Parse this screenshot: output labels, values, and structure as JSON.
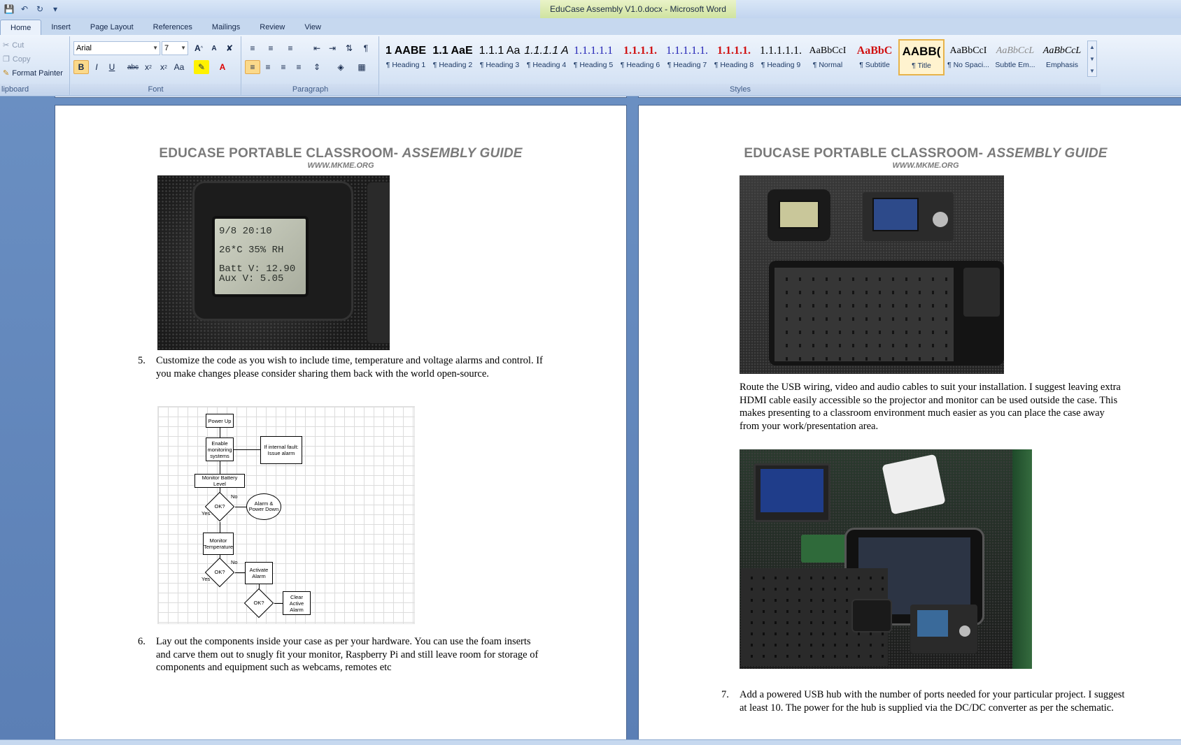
{
  "window": {
    "title": "EduCase Assembly V1.0.docx - Microsoft Word"
  },
  "tabs": [
    "Home",
    "Insert",
    "Page Layout",
    "References",
    "Mailings",
    "Review",
    "View"
  ],
  "clipboard": {
    "cut": "Cut",
    "copy": "Copy",
    "format_painter": "Format Painter",
    "label": "lipboard"
  },
  "font": {
    "name": "Arial",
    "size": "7",
    "label": "Font"
  },
  "paragraph": {
    "label": "Paragraph"
  },
  "styles": {
    "label": "Styles",
    "items": [
      {
        "sample": "1  AABE",
        "name": "¶ Heading 1"
      },
      {
        "sample": "1.1  AaE",
        "name": "¶ Heading 2"
      },
      {
        "sample": "1.1.1  Aa",
        "name": "¶ Heading 3"
      },
      {
        "sample": "1.1.1.1  A",
        "name": "¶ Heading 4"
      },
      {
        "sample": "1.1.1.1.1",
        "name": "¶ Heading 5"
      },
      {
        "sample": "1.1.1.1.",
        "name": "¶ Heading 6"
      },
      {
        "sample": "1.1.1.1.1.",
        "name": "¶ Heading 7"
      },
      {
        "sample": "1.1.1.1.",
        "name": "¶ Heading 8"
      },
      {
        "sample": "1.1.1.1.1.",
        "name": "¶ Heading 9"
      },
      {
        "sample": "AaBbCcI",
        "name": "¶ Normal"
      },
      {
        "sample": "AaBbC",
        "name": "¶ Subtitle"
      },
      {
        "sample": "AABB(",
        "name": "¶ Title"
      },
      {
        "sample": "AaBbCcI",
        "name": "¶ No Spaci..."
      },
      {
        "sample": "AaBbCcL",
        "name": "Subtle Em..."
      },
      {
        "sample": "AaBbCcL",
        "name": "Emphasis"
      }
    ]
  },
  "page_left": {
    "header_title": "EDUCASE PORTABLE CLASSROOM- ",
    "header_title_italic": "ASSEMBLY GUIDE",
    "header_url": "WWW.MKME.ORG",
    "lcd": {
      "line1": "9/8  20:10",
      "line2": "26*C  35% RH",
      "line3": "Batt V: 12.90",
      "line4": "Aux V: 5.05"
    },
    "step5_num": "5.",
    "step5_text": "Customize the code as you wish to include time, temperature and voltage alarms and control.  If you make changes please consider sharing them back with the world open-source.",
    "flowchart": {
      "power_up": "Power Up",
      "enable": "Enable monitoring systems",
      "fault": "If internal fault: Issue alarm",
      "battery": "Monitor Battery Level",
      "ok1": "OK?",
      "no1": "No",
      "yes1": "Yes",
      "alarm_power": "Alarm & Power Down",
      "temp": "Monitor Temperature",
      "ok2": "OK?",
      "no2": "No",
      "yes2": "Yes",
      "activate": "Activate Alarm",
      "ok3": "OK?",
      "clear": "Clear Active Alarm"
    },
    "step6_num": "6.",
    "step6_text": "Lay out the components inside your case as per your hardware.  You can use the foam inserts and carve them out to snugly fit your monitor, Raspberry Pi and still leave room for storage of components and equipment such as webcams, remotes etc"
  },
  "page_right": {
    "header_title": "EDUCASE PORTABLE CLASSROOM- ",
    "header_title_italic": "ASSEMBLY GUIDE",
    "header_url": "WWW.MKME.ORG",
    "route_text": "Route the USB wiring, video and audio cables to suit your installation. I suggest leaving extra HDMI cable easily accessible so the projector and monitor can be used outside the case. This makes presenting to a classroom environment much easier as you can place the case away from your work/presentation area.",
    "step7_num": "7.",
    "step7_text": "Add a powered USB hub with the number of ports needed for your particular project. I suggest at least 10.  The power for the hub is supplied via the DC/DC converter as per the schematic."
  }
}
